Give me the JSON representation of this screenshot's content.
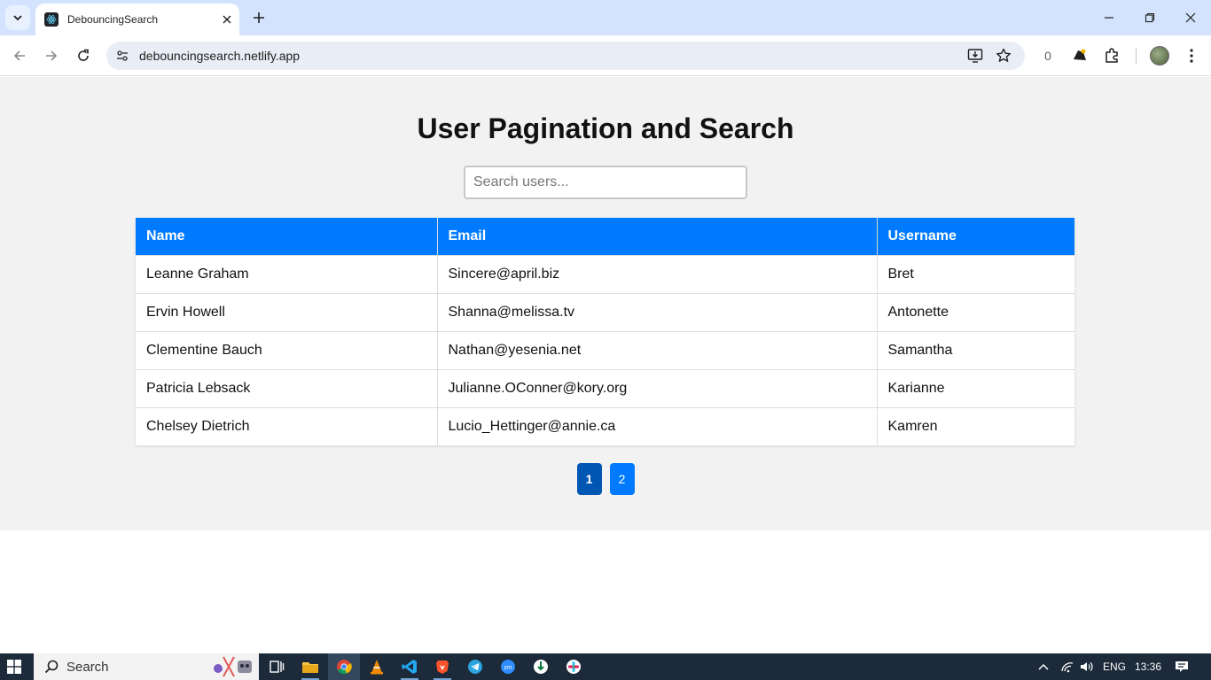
{
  "browser": {
    "tab_title": "DebouncingSearch",
    "url": "debouncingsearch.netlify.app",
    "extension_badge": "0"
  },
  "page": {
    "title": "User Pagination and Search",
    "search": {
      "placeholder": "Search users...",
      "value": ""
    },
    "table": {
      "headers": [
        "Name",
        "Email",
        "Username"
      ],
      "rows": [
        [
          "Leanne Graham",
          "Sincere@april.biz",
          "Bret"
        ],
        [
          "Ervin Howell",
          "Shanna@melissa.tv",
          "Antonette"
        ],
        [
          "Clementine Bauch",
          "Nathan@yesenia.net",
          "Samantha"
        ],
        [
          "Patricia Lebsack",
          "Julianne.OConner@kory.org",
          "Karianne"
        ],
        [
          "Chelsey Dietrich",
          "Lucio_Hettinger@annie.ca",
          "Kamren"
        ]
      ]
    },
    "pagination": {
      "pages": [
        "1",
        "2"
      ],
      "current": "1"
    },
    "colors": {
      "header_bg": "#007bff",
      "active_page": "#0056b3",
      "page_bg": "#f2f2f2"
    }
  },
  "taskbar": {
    "search_label": "Search",
    "language": "ENG",
    "time": "13:36"
  }
}
